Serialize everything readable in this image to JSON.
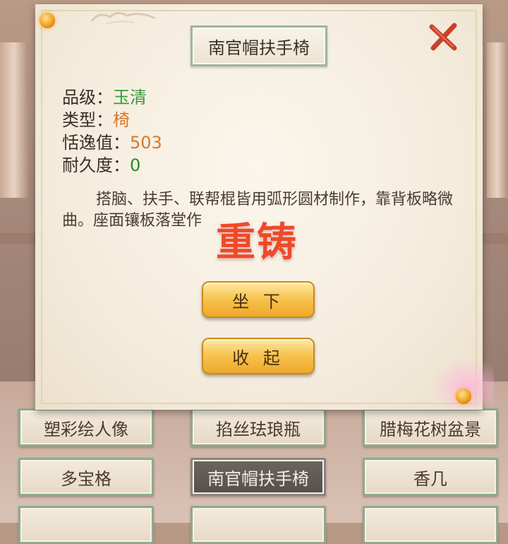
{
  "dialog": {
    "title": "南官帽扶手椅",
    "attributes": [
      {
        "label": "品级：",
        "value": "玉清"
      },
      {
        "label": "类型：",
        "value": "椅"
      },
      {
        "label": "恬逸值：",
        "value": "503"
      },
      {
        "label": "耐久度：",
        "value": "0"
      }
    ],
    "description": "搭脑、扶手、联帮棍皆用弧形圆材制作，靠背板略微曲。座面镶板落堂作",
    "watermark": "重铸",
    "buttons": {
      "sit": "坐 下",
      "stow": "收 起"
    }
  },
  "grid": {
    "row1": [
      "塑彩绘人像",
      "掐丝珐琅瓶",
      "腊梅花树盆景"
    ],
    "row2": [
      "多宝格",
      "南官帽扶手椅",
      "香几"
    ]
  },
  "colors": {
    "grade_value": "#3a9a3a",
    "number_value": "#d8782a",
    "watermark": "#ee4a2a",
    "gold_button": "#f7c552"
  }
}
